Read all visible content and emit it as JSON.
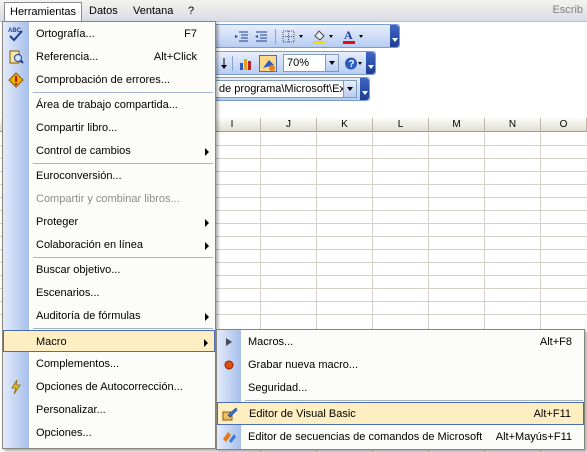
{
  "menubar": {
    "items": [
      {
        "label": "Herramientas"
      },
      {
        "label": "Datos"
      },
      {
        "label": "Ventana"
      },
      {
        "label": "?"
      }
    ],
    "search_hint": "Escrib"
  },
  "toolbar": {
    "zoom_value": "70%",
    "path_value": "de programa\\Microsoft\\Ex"
  },
  "sheet": {
    "columns": [
      "I",
      "J",
      "K",
      "L",
      "M",
      "N",
      "O"
    ]
  },
  "tools_menu": {
    "items": [
      {
        "label": "Ortografía...",
        "shortcut": "F7",
        "icon": "spelling-icon"
      },
      {
        "label": "Referencia...",
        "shortcut": "Alt+Click",
        "icon": "research-icon"
      },
      {
        "label": "Comprobación de errores...",
        "shortcut": "",
        "icon": "error-check-icon"
      },
      {
        "label": "Área de trabajo compartida...",
        "shortcut": ""
      },
      {
        "label": "Compartir libro...",
        "shortcut": ""
      },
      {
        "label": "Control de cambios",
        "shortcut": "",
        "submenu": true
      },
      {
        "label": "Euroconversión...",
        "shortcut": ""
      },
      {
        "label": "Compartir y combinar libros...",
        "shortcut": "",
        "disabled": true
      },
      {
        "label": "Proteger",
        "shortcut": "",
        "submenu": true
      },
      {
        "label": "Colaboración en línea",
        "shortcut": "",
        "submenu": true
      },
      {
        "label": "Buscar objetivo...",
        "shortcut": ""
      },
      {
        "label": "Escenarios...",
        "shortcut": ""
      },
      {
        "label": "Auditoría de fórmulas",
        "shortcut": "",
        "submenu": true
      },
      {
        "label": "Macro",
        "shortcut": "",
        "submenu": true,
        "highlighted": true
      },
      {
        "label": "Complementos...",
        "shortcut": ""
      },
      {
        "label": "Opciones de Autocorrección...",
        "shortcut": "",
        "icon": "autocorrect-icon"
      },
      {
        "label": "Personalizar...",
        "shortcut": ""
      },
      {
        "label": "Opciones...",
        "shortcut": ""
      }
    ]
  },
  "macro_submenu": {
    "items": [
      {
        "label": "Macros...",
        "shortcut": "Alt+F8",
        "icon": "play-icon"
      },
      {
        "label": "Grabar nueva macro...",
        "shortcut": "",
        "icon": "record-icon"
      },
      {
        "label": "Seguridad...",
        "shortcut": ""
      },
      {
        "label": "Editor de Visual Basic",
        "shortcut": "Alt+F11",
        "icon": "vb-editor-icon",
        "highlighted": true
      },
      {
        "label": "Editor de secuencias de comandos de Microsoft",
        "shortcut": "Alt+Mayús+F11",
        "icon": "script-editor-icon"
      }
    ]
  },
  "colors": {
    "highlight_bg": "#ffeec2",
    "highlight_border": "#4a6fb8",
    "toolbar_blue": "#b7cdf2",
    "font_color_red": "#e01010"
  }
}
